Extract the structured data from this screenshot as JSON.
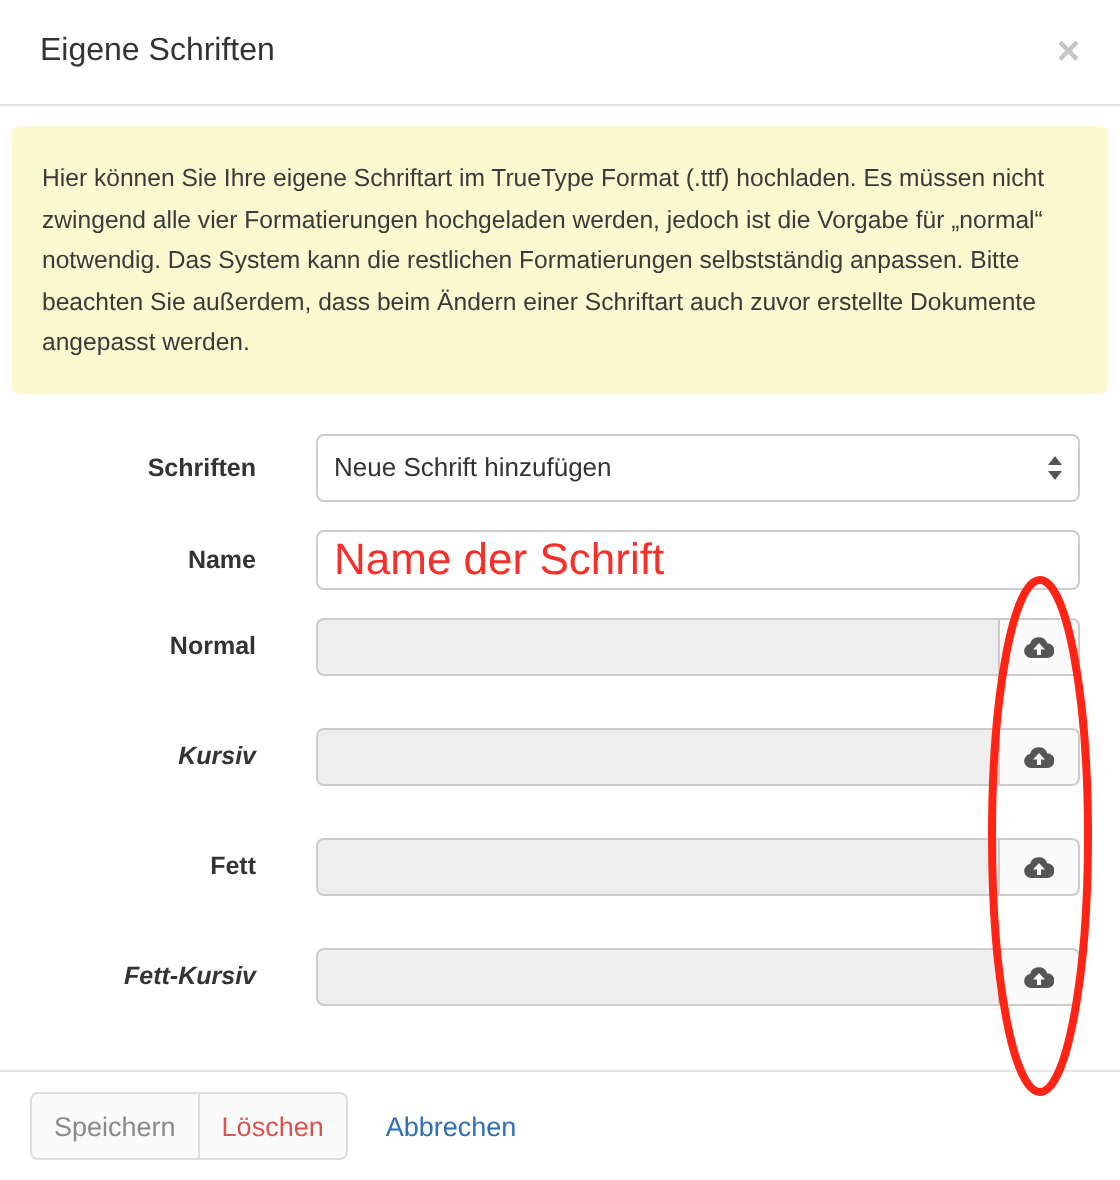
{
  "dialog": {
    "title": "Eigene Schriften",
    "close": "×"
  },
  "notice": "Hier können Sie Ihre eigene Schriftart im TrueType Format (.ttf) hochladen. Es müssen nicht zwingend alle vier Formatierungen hochgeladen werden, jedoch ist die Vorgabe für „normal“ notwendig. Das System kann die restlichen Formatierungen selbstständig anpassen. Bitte beachten Sie außerdem, dass beim Ändern einer Schriftart auch zuvor erstellte Dokumente angepasst werden.",
  "fields": [
    {
      "kind": "select",
      "label": "Schriften",
      "italic": false,
      "value": "Neue Schrift hinzufügen"
    },
    {
      "kind": "text",
      "label": "Name",
      "italic": false,
      "value": "Name der Schrift"
    },
    {
      "kind": "file",
      "label": "Normal",
      "italic": false,
      "disabled": true
    },
    {
      "kind": "file",
      "label": "Kursiv",
      "italic": true,
      "disabled": true
    },
    {
      "kind": "file",
      "label": "Fett",
      "italic": false,
      "disabled": true
    },
    {
      "kind": "file",
      "label": "Fett-Kursiv",
      "italic": true,
      "disabled": true
    }
  ],
  "buttons": [
    {
      "kind": "default",
      "label": "Speichern",
      "disabled": true
    },
    {
      "kind": "danger",
      "label": "Löschen",
      "disabled": false
    },
    {
      "kind": "link",
      "label": "Abbrechen",
      "disabled": false
    }
  ],
  "annotations": [
    {
      "kind": "ellipse"
    }
  ]
}
